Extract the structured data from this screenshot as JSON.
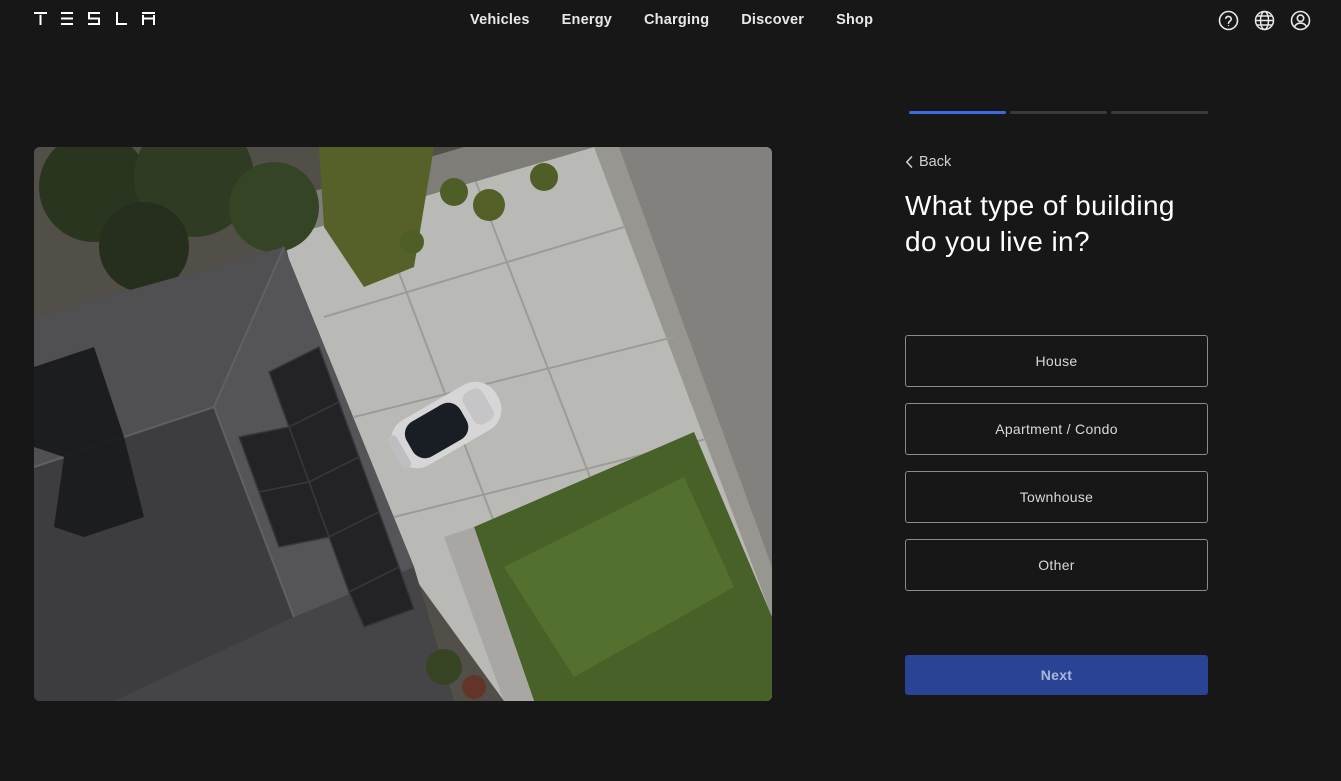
{
  "brand": {
    "logo": "TESLA",
    "logo_icon": "tesla-wordmark-icon"
  },
  "nav": {
    "items": [
      {
        "label": "Vehicles"
      },
      {
        "label": "Energy"
      },
      {
        "label": "Charging"
      },
      {
        "label": "Discover"
      },
      {
        "label": "Shop"
      }
    ],
    "icons": [
      "help-icon",
      "globe-icon",
      "account-icon"
    ]
  },
  "hero": {
    "image": "aerial-house-solar-roof-car-driveway"
  },
  "wizard": {
    "progress": {
      "current_step": 1,
      "total_steps": 3
    },
    "back_label": "Back",
    "question": "What type of building do you live in?",
    "options": [
      {
        "label": "House"
      },
      {
        "label": "Apartment / Condo"
      },
      {
        "label": "Townhouse"
      },
      {
        "label": "Other"
      }
    ],
    "next_label": "Next"
  },
  "colors": {
    "background": "#171717",
    "accent": "#3e6ae1",
    "next_button": "#2a4394",
    "option_border": "#8a8a8a"
  }
}
